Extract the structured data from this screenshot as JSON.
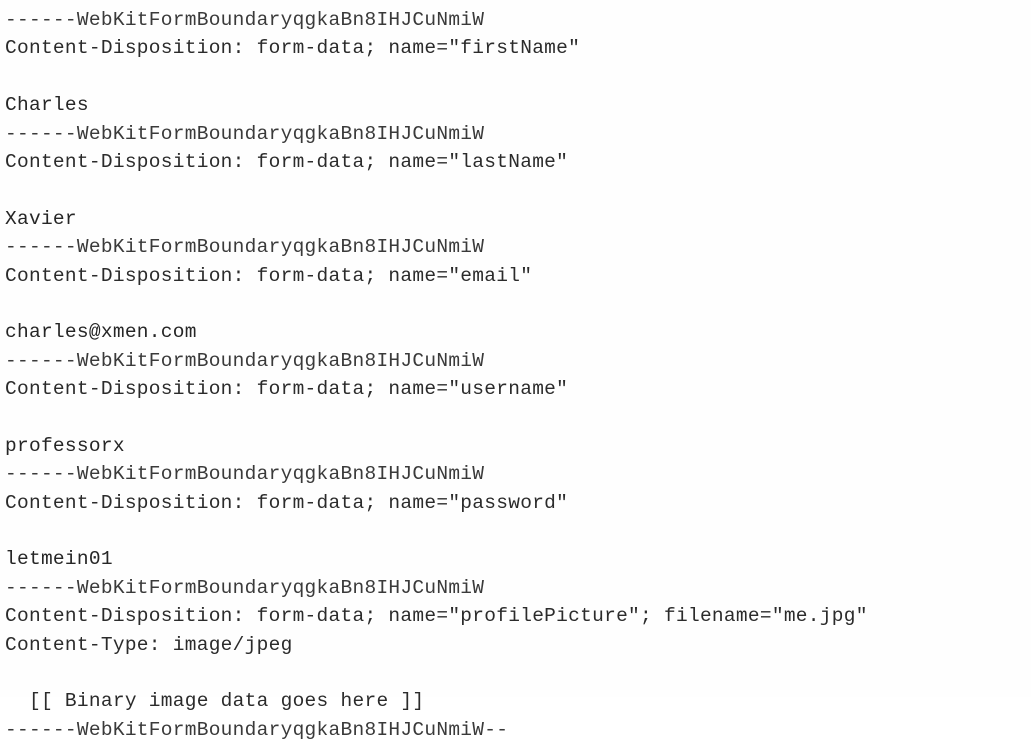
{
  "document": {
    "kind": "http-multipart-form-data-body",
    "boundary_token": "------WebKitFormBoundaryqgkaBn8IHJCuNmiW",
    "closing_boundary_token": "------WebKitFormBoundaryqgkaBn8IHJCuNmiW--",
    "content_type_line": "Content-Type: image/jpeg",
    "binary_placeholder": "  [[ Binary image data goes here ]]",
    "colors": {
      "background": "#fefefe",
      "text": "#2b2b2b"
    },
    "lines": [
      "------WebKitFormBoundaryqgkaBn8IHJCuNmiW",
      "Content-Disposition: form-data; name=\"firstName\"",
      "",
      "Charles",
      "------WebKitFormBoundaryqgkaBn8IHJCuNmiW",
      "Content-Disposition: form-data; name=\"lastName\"",
      "",
      "Xavier",
      "------WebKitFormBoundaryqgkaBn8IHJCuNmiW",
      "Content-Disposition: form-data; name=\"email\"",
      "",
      "charles@xmen.com",
      "------WebKitFormBoundaryqgkaBn8IHJCuNmiW",
      "Content-Disposition: form-data; name=\"username\"",
      "",
      "professorx",
      "------WebKitFormBoundaryqgkaBn8IHJCuNmiW",
      "Content-Disposition: form-data; name=\"password\"",
      "",
      "letmein01",
      "------WebKitFormBoundaryqgkaBn8IHJCuNmiW",
      "Content-Disposition: form-data; name=\"profilePicture\"; filename=\"me.jpg\"",
      "Content-Type: image/jpeg",
      "",
      "  [[ Binary image data goes here ]]",
      "------WebKitFormBoundaryqgkaBn8IHJCuNmiW--"
    ],
    "line_roles": [
      "boundary",
      "header",
      "blank",
      "value",
      "boundary",
      "header",
      "blank",
      "value",
      "boundary",
      "header",
      "blank",
      "value",
      "boundary",
      "header",
      "blank",
      "value",
      "boundary",
      "header",
      "blank",
      "value",
      "boundary",
      "header",
      "header",
      "blank",
      "binary",
      "boundary"
    ],
    "parts": [
      {
        "name": "firstName",
        "value": "Charles"
      },
      {
        "name": "lastName",
        "value": "Xavier"
      },
      {
        "name": "email",
        "value": "charles@xmen.com"
      },
      {
        "name": "username",
        "value": "professorx"
      },
      {
        "name": "password",
        "value": "letmein01"
      },
      {
        "name": "profilePicture",
        "filename": "me.jpg",
        "content_type": "image/jpeg",
        "value": "[[ Binary image data goes here ]]"
      }
    ]
  }
}
